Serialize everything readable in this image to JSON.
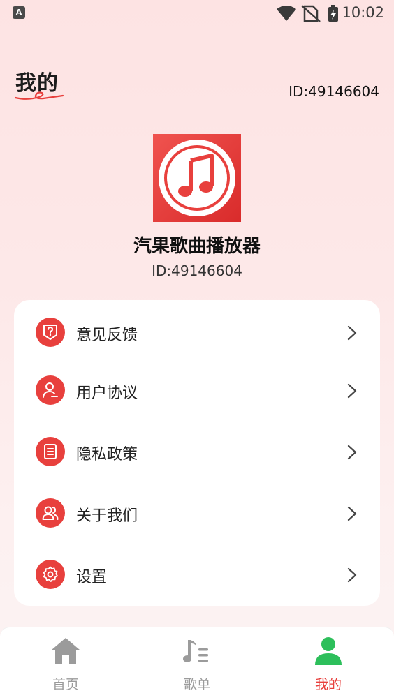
{
  "status_bar": {
    "app_badge": "A",
    "time": "10:02"
  },
  "header": {
    "title": "我的",
    "user_id": "ID:49146604"
  },
  "profile": {
    "app_name": "汽果歌曲播放器",
    "app_id": "ID:49146604"
  },
  "menu": {
    "items": [
      {
        "label": "意见反馈",
        "icon": "feedback-question-icon"
      },
      {
        "label": "用户协议",
        "icon": "user-agreement-icon"
      },
      {
        "label": "隐私政策",
        "icon": "privacy-document-icon"
      },
      {
        "label": "关于我们",
        "icon": "about-users-icon"
      },
      {
        "label": "设置",
        "icon": "settings-gear-icon"
      }
    ]
  },
  "bottom_nav": {
    "items": [
      {
        "label": "首页",
        "icon": "home-icon",
        "active": false
      },
      {
        "label": "歌单",
        "icon": "playlist-icon",
        "active": false
      },
      {
        "label": "我的",
        "icon": "profile-icon",
        "active": true
      }
    ]
  },
  "colors": {
    "accent": "#e8403d",
    "active_nav_icon": "#2dbf5b",
    "inactive_nav": "#9b9b9b"
  }
}
